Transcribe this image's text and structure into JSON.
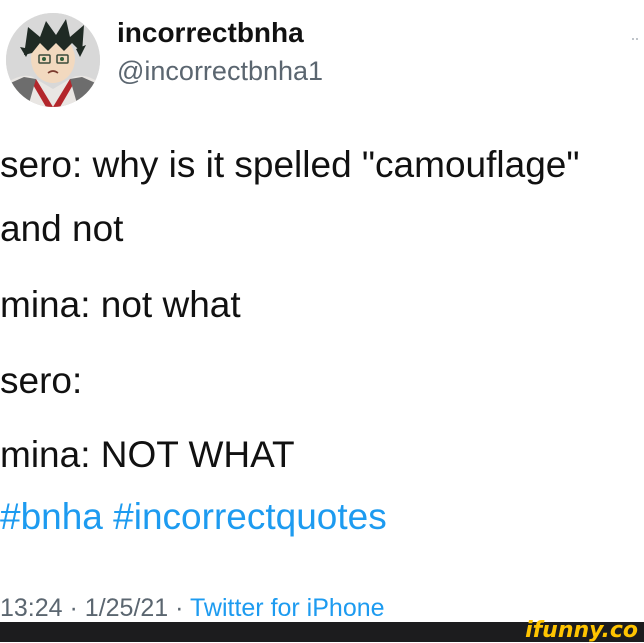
{
  "tweet": {
    "display_name": "incorrectbnha",
    "handle": "@incorrectbnha1",
    "more_icon": "more-dots-icon",
    "lines": [
      "sero: why is it spelled \"camouflage\"",
      "and not",
      "mina: not what",
      "sero:",
      "mina: NOT WHAT"
    ],
    "hashtags": [
      "#bnha",
      "#incorrectquotes"
    ],
    "time": "13:24",
    "separator": "·",
    "date": "1/25/21",
    "source": "Twitter for iPhone"
  },
  "watermark": {
    "text": "ifunny.co"
  },
  "colors": {
    "link": "#1d9bf0",
    "muted": "#5b6670",
    "watermark": "#ffc400",
    "footer_bar": "#1c1c1e"
  }
}
